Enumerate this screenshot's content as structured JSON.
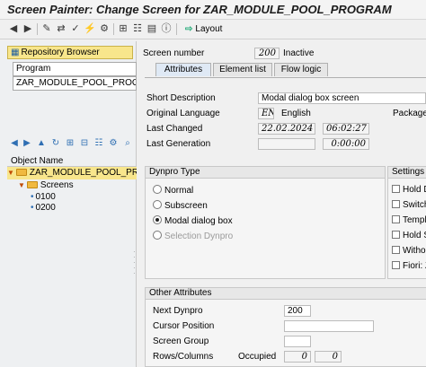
{
  "window": {
    "title": "Screen Painter: Change Screen for ZAR_MODULE_POOL_PROGRAM"
  },
  "toolbar": {
    "layout_label": "Layout",
    "icons": [
      "back-icon",
      "forward-icon",
      "display-change-icon",
      "other-object-icon",
      "activate-icon",
      "test-icon",
      "where-used-icon",
      "object-list-icon",
      "hierarchy-icon",
      "display-object-list-icon",
      "help-icon",
      "layout-icon"
    ]
  },
  "left": {
    "repository_browser": "Repository Browser",
    "object_type": "Program",
    "object_name": "ZAR_MODULE_POOL_PROGRA",
    "object_name_header": "Object Name",
    "tree": {
      "root": "ZAR_MODULE_POOL_PROGR",
      "folder": "Screens",
      "items": [
        "0100",
        "0200"
      ]
    }
  },
  "right": {
    "screen_number_label": "Screen number",
    "screen_number": "200",
    "status": "Inactive",
    "tabs": [
      "Attributes",
      "Element list",
      "Flow logic"
    ],
    "short_description_label": "Short Description",
    "short_description": "Modal dialog box screen",
    "original_language_label": "Original Language",
    "original_language_code": "EN",
    "original_language_name": "English",
    "package_label": "Package",
    "last_changed_label": "Last Changed",
    "last_changed_date": "22.02.2024",
    "last_changed_time": "06:02:27",
    "last_generation_label": "Last Generation",
    "last_generation_date": "",
    "last_generation_time": "0:00:00",
    "dynpro_type": {
      "header": "Dynpro Type",
      "options": [
        "Normal",
        "Subscreen",
        "Modal dialog box",
        "Selection Dynpro"
      ],
      "selected": "Modal dialog box"
    },
    "settings": {
      "header": "Settings",
      "items": [
        "Hold D",
        "Switch",
        "Templa",
        "Hold S",
        "Withou",
        "Fiori: Z"
      ]
    },
    "other_attributes": {
      "header": "Other Attributes",
      "next_dynpro_label": "Next Dynpro",
      "next_dynpro": "200",
      "cursor_position_label": "Cursor Position",
      "screen_group_label": "Screen Group",
      "rows_columns_label": "Rows/Columns",
      "occupied_label": "Occupied",
      "occupied_rows": "0",
      "occupied_cols": "0"
    }
  }
}
